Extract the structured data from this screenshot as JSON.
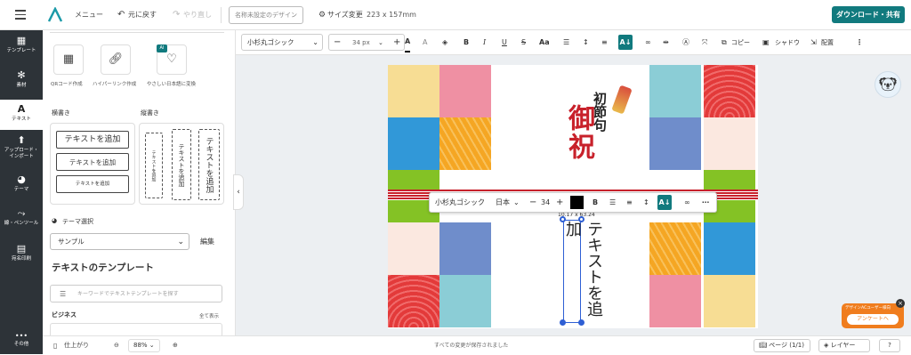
{
  "header": {
    "menu_label": "メニュー",
    "undo_label": "元に戻す",
    "redo_label": "やり直し",
    "doc_name_placeholder": "名称未設定のデザイン",
    "size_change_label": "サイズ変更",
    "size_value": "223 x 157mm",
    "download_label": "ダウンロード・共有"
  },
  "rail": {
    "items": [
      {
        "label": "テンプレート",
        "icon": "template-icon"
      },
      {
        "label": "素材",
        "icon": "gear-icon"
      },
      {
        "label": "テキスト",
        "icon": "text-icon"
      },
      {
        "label": "アップロード・インポート",
        "label_line1": "アップロード・",
        "label_line2": "インポート",
        "icon": "upload-icon"
      },
      {
        "label": "テーマ",
        "icon": "palette-icon"
      },
      {
        "label": "線・ペンツール",
        "icon": "pen-icon"
      },
      {
        "label": "宛名印刷",
        "icon": "print-icon"
      },
      {
        "label": "その他",
        "icon": "more-icon"
      }
    ]
  },
  "panel": {
    "tools": [
      {
        "label": "QRコード作成",
        "icon": "qr-icon"
      },
      {
        "label": "ハイパーリンク作成",
        "icon": "link-icon"
      },
      {
        "label": "やさしい日本語に変換",
        "icon": "ai-convert-icon",
        "badge": "AI"
      }
    ],
    "horizontal_title": "横書き",
    "vertical_title": "縦書き",
    "add_text_large": "テキストを追加",
    "add_text_medium": "テキストを追加",
    "add_text_small": "テキストを追加",
    "theme_select_label": "テーマ選択",
    "theme_value": "サンプル",
    "edit_label": "編集",
    "template_heading": "テキストのテンプレート",
    "search_placeholder": "キーワードでテキストテンプレートを探す",
    "business_label": "ビジネス",
    "show_all_label": "全て表示"
  },
  "format_toolbar": {
    "font": "小杉丸ゴシック",
    "size": "34 px",
    "copy_label": "コピー",
    "shadow_label": "シャドウ",
    "arrange_label": "配置"
  },
  "floating_toolbar": {
    "font": "小杉丸ゴシック",
    "lang": "日本",
    "size": "34",
    "color": "#000000"
  },
  "canvas": {
    "title_big": "御祝",
    "title_small": "初節句",
    "selected_text": "テキストを追加",
    "dimension_label": "10.17 x 63.24"
  },
  "status": {
    "finish_label": "仕上がり",
    "zoom": "88%",
    "saved_label": "すべての変更が保存されました",
    "page_label": "ページ",
    "page_count": "(1/1)",
    "layer_label": "レイヤー",
    "help_label": "?"
  },
  "survey": {
    "line1": "デザインACユーザー様向",
    "button": "アンケートへ"
  },
  "colors": {
    "accent": "#117a7e",
    "rail": "#2d3338",
    "red": "#c8212b"
  }
}
